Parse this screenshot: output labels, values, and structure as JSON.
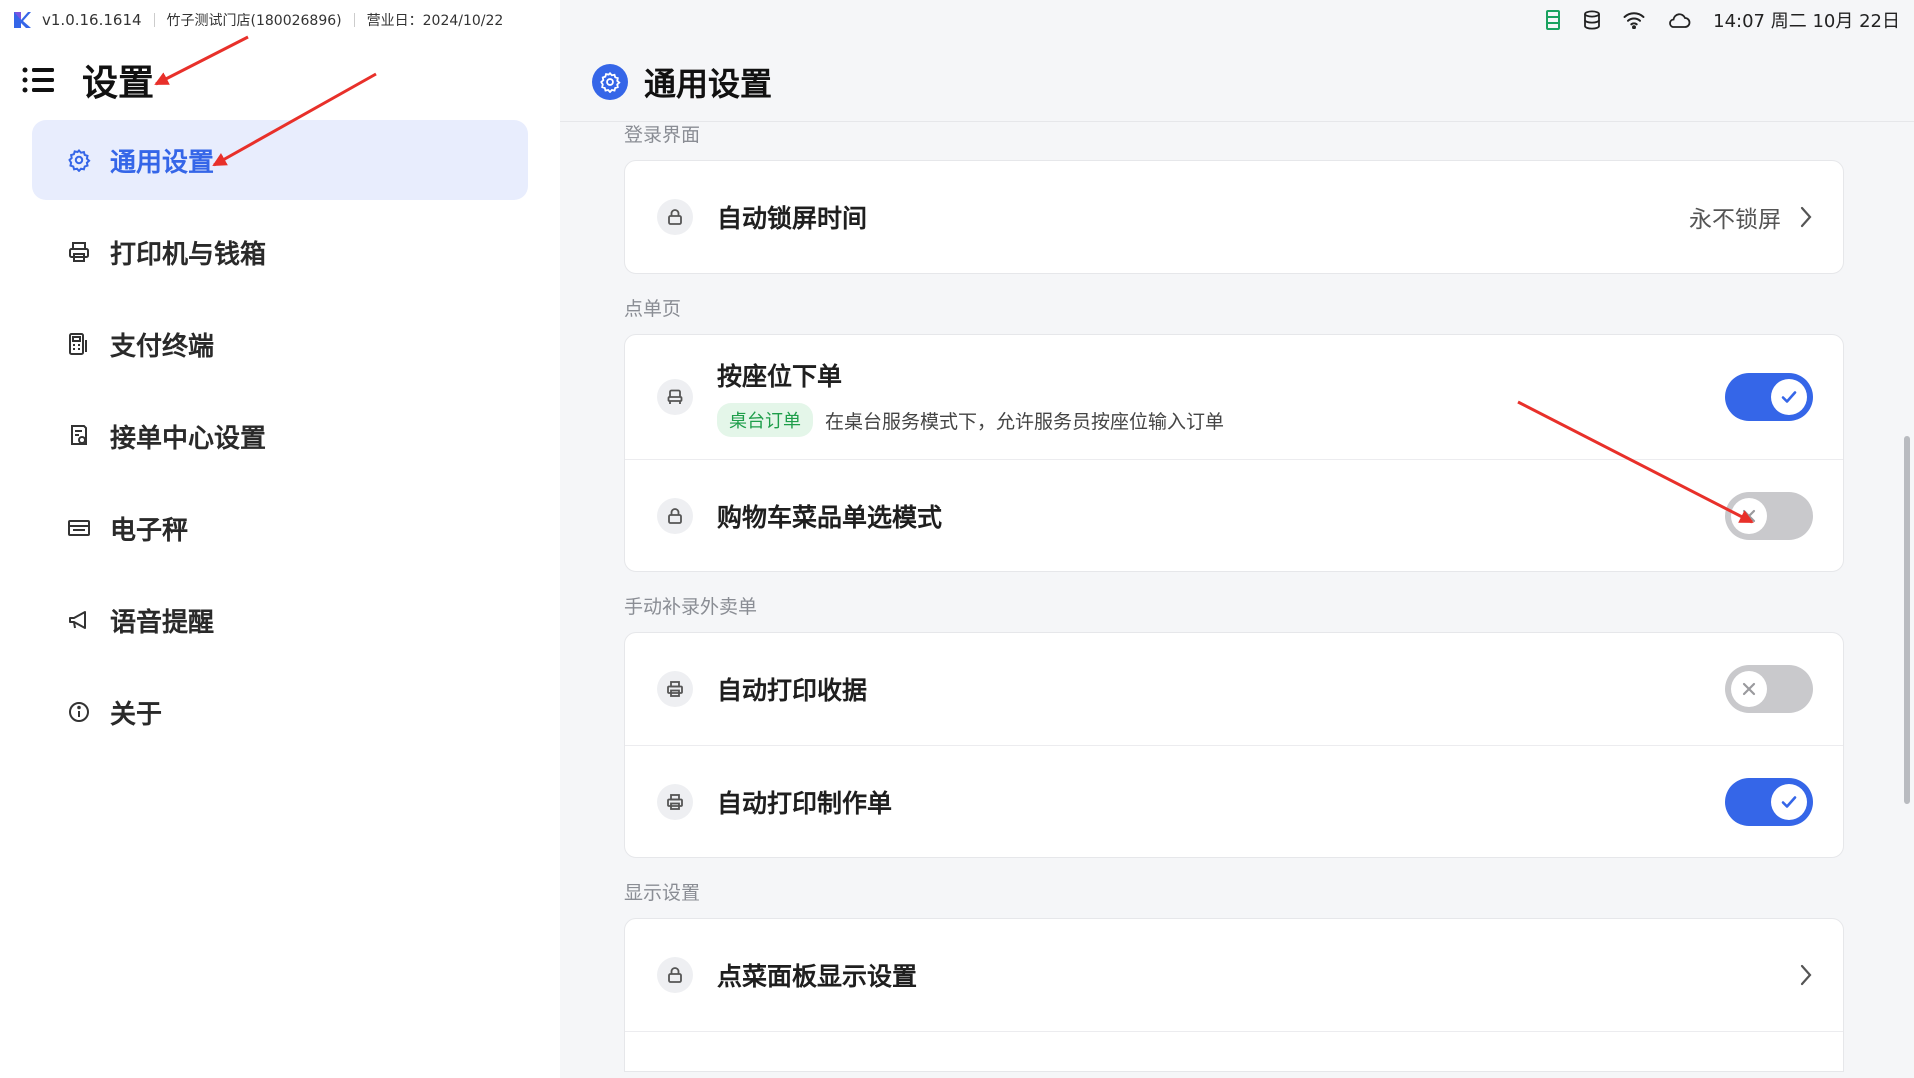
{
  "app": {
    "version": "v1.0.16.1614",
    "store": "竹子测试门店(180026896)",
    "business_date": "营业日：2024/10/22"
  },
  "status": {
    "time": "14:07 周二 10月 22日"
  },
  "sidebar": {
    "title": "设置",
    "items": [
      {
        "label": "通用设置",
        "icon": "gear-icon",
        "active": true
      },
      {
        "label": "打印机与钱箱",
        "icon": "printer-icon",
        "active": false
      },
      {
        "label": "支付终端",
        "icon": "pos-terminal-icon",
        "active": false
      },
      {
        "label": "接单中心设置",
        "icon": "order-center-icon",
        "active": false
      },
      {
        "label": "电子秤",
        "icon": "scale-icon",
        "active": false
      },
      {
        "label": "语音提醒",
        "icon": "megaphone-icon",
        "active": false
      },
      {
        "label": "关于",
        "icon": "info-icon",
        "active": false
      }
    ]
  },
  "page": {
    "title": "通用设置"
  },
  "sections": {
    "login": {
      "title": "登录界面",
      "auto_lock": {
        "label": "自动锁屏时间",
        "value": "永不锁屏"
      }
    },
    "order_page": {
      "title": "点单页",
      "by_seat": {
        "label": "按座位下单",
        "tag": "桌台订单",
        "desc": "在桌台服务模式下，允许服务员按座位输入订单",
        "enabled": true
      },
      "cart_single": {
        "label": "购物车菜品单选模式",
        "enabled": false
      }
    },
    "manual_delivery": {
      "title": "手动补录外卖单",
      "auto_print_receipt": {
        "label": "自动打印收据",
        "enabled": false
      },
      "auto_print_production": {
        "label": "自动打印制作单",
        "enabled": true
      }
    },
    "display": {
      "title": "显示设置",
      "menu_panel": {
        "label": "点菜面板显示设置"
      }
    }
  },
  "colors": {
    "accent": "#3566e8",
    "active_nav_bg": "#e8edfd",
    "toggle_off": "#c9c9cc",
    "tag_bg": "#e4f6e9",
    "tag_text": "#1e9e4a",
    "annotation_arrow": "#e8302a"
  }
}
